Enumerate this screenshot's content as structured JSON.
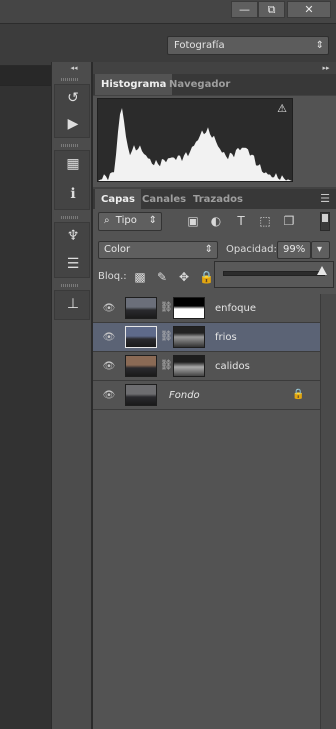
{
  "window": {
    "minimize_label": "—",
    "restore_label": "⧉",
    "close_label": "✕"
  },
  "options_bar": {
    "workspace_value": "Fotografía",
    "workspace_arrow": "⇕"
  },
  "toolbar": {
    "collapse_label": "◂◂",
    "tools": [
      {
        "icon": "history-brush-icon",
        "glyph": "↺"
      },
      {
        "icon": "play-action-icon",
        "glyph": "▶"
      },
      {
        "icon": "properties-3d-icon",
        "glyph": "▦"
      },
      {
        "icon": "info-icon",
        "glyph": "ℹ"
      },
      {
        "icon": "brush-presets-icon",
        "glyph": "♆"
      },
      {
        "icon": "adjustment-sliders-icon",
        "glyph": "☰"
      },
      {
        "icon": "clone-source-icon",
        "glyph": "⊥"
      }
    ]
  },
  "panels": {
    "expand_label": "▸▸",
    "histogram_tabs": [
      "Histograma",
      "Navegador"
    ],
    "histogram_warning": "⚠",
    "layers_tabs": [
      "Capas",
      "Canales",
      "Trazados"
    ],
    "panel_menu": "☰",
    "filter": {
      "search_glyph": "⌕",
      "kind_value": "Tipo",
      "kind_arrow": "⇕",
      "icons": [
        {
          "icon": "image-filter-icon",
          "glyph": "▣"
        },
        {
          "icon": "adjustment-filter-icon",
          "glyph": "◐"
        },
        {
          "icon": "type-filter-icon",
          "glyph": "T"
        },
        {
          "icon": "shape-filter-icon",
          "glyph": "⬚"
        },
        {
          "icon": "smart-object-filter-icon",
          "glyph": "❐"
        }
      ]
    },
    "blend_mode": "Color",
    "blend_arrow": "⇕",
    "opacity_label": "Opacidad:",
    "opacity_value": "99%",
    "opacity_arrow": "▾",
    "opacity_level": 0.99,
    "lock_label": "Bloq.:",
    "lock_icons": [
      {
        "icon": "lock-transparent-icon",
        "glyph": "▩"
      },
      {
        "icon": "lock-image-icon",
        "glyph": "✎"
      },
      {
        "icon": "lock-position-icon",
        "glyph": "✥"
      },
      {
        "icon": "lock-all-icon",
        "glyph": "🔒"
      }
    ],
    "layers": [
      {
        "name": "enfoque",
        "selected": false,
        "has_mask": true,
        "locked": false,
        "italic": false,
        "thumb_color": "#6b6f7a",
        "mask": "white-top"
      },
      {
        "name": "frios",
        "selected": true,
        "has_mask": true,
        "locked": false,
        "italic": false,
        "thumb_color": "#5e6a8a",
        "mask": "landscape"
      },
      {
        "name": "calidos",
        "selected": false,
        "has_mask": true,
        "locked": false,
        "italic": false,
        "thumb_color": "#8a6a55",
        "mask": "landscape"
      },
      {
        "name": "Fondo",
        "selected": false,
        "has_mask": false,
        "locked": true,
        "italic": true,
        "thumb_color": "#6d6d70",
        "mask": "none"
      }
    ],
    "eye_glyph": "👁",
    "chain_glyph": "⛓",
    "layer_lock_glyph": "🔒"
  },
  "colors": {
    "selection": "#5b6375",
    "panel_bg": "#535353"
  }
}
